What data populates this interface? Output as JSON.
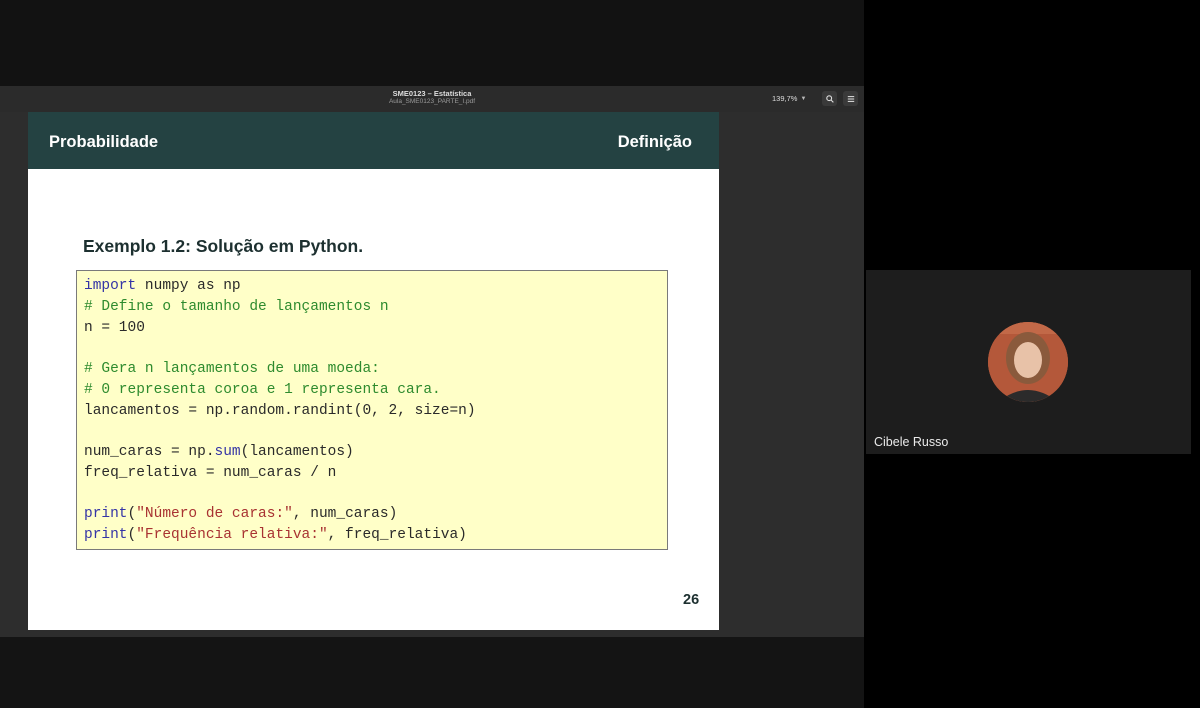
{
  "viewer": {
    "title": "SME0123 – Estatística",
    "subtitle": "Aula_SME0123_PARTE_I.pdf",
    "zoom": "139,7%",
    "icons": {
      "zoom_dropdown": "chevron-down-icon",
      "search": "search-icon",
      "menu": "hamburger-menu-icon"
    }
  },
  "slide": {
    "header_left": "Probabilidade",
    "header_right": "Definição",
    "example_title": "Exemplo 1.2: Solução em Python.",
    "page_number": "26",
    "code": {
      "l1_kw": "import",
      "l1_rest": " numpy as np",
      "l2": "# Define o tamanho de lançamentos n",
      "l3": "n = 100",
      "l5": "# Gera n lançamentos de uma moeda:",
      "l6": "# 0 representa coroa e 1 representa cara.",
      "l7": "lancamentos = np.random.randint(0, 2, size=n)",
      "l9_a": "num_caras = np.",
      "l9_kw": "sum",
      "l9_b": "(lancamentos)",
      "l10": "freq_relativa = num_caras / n",
      "l12_kw": "print",
      "l12_a": "(",
      "l12_str": "\"Número de caras:\"",
      "l12_b": ", num_caras)",
      "l13_kw": "print",
      "l13_a": "(",
      "l13_str": "\"Frequência relativa:\"",
      "l13_b": ", freq_relativa)"
    }
  },
  "participant": {
    "name": "Cibele Russo"
  },
  "colors": {
    "slide_header": "#244242",
    "code_background": "#ffffc8",
    "keyword": "#3434a6",
    "comment": "#2e8b2e",
    "string": "#a83232"
  }
}
